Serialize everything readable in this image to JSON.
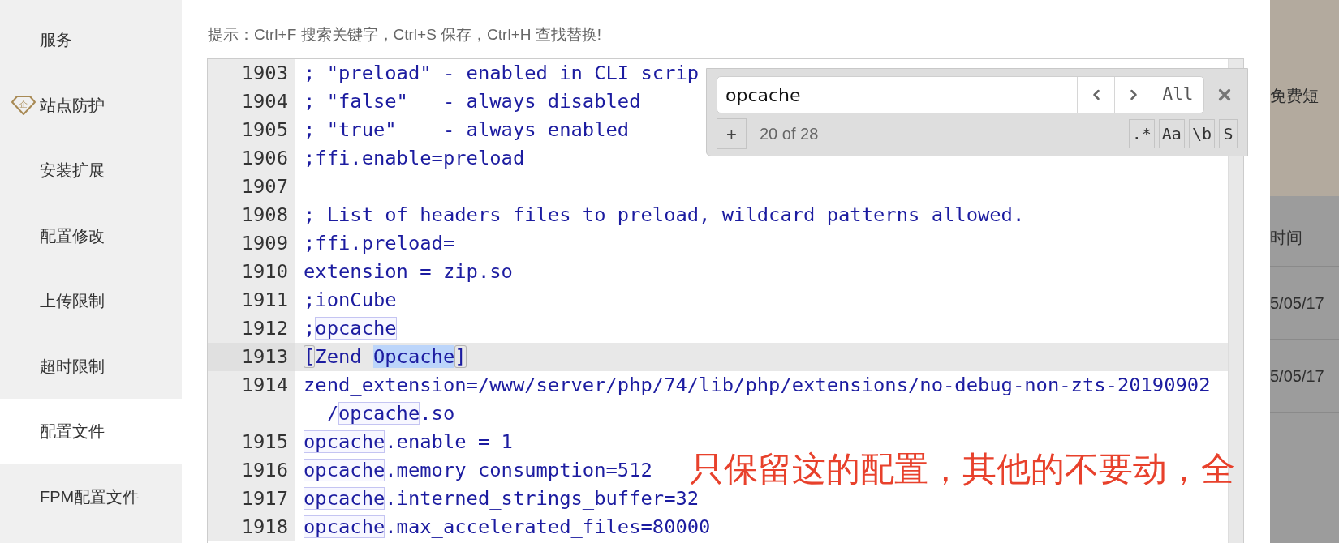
{
  "sidebar": {
    "items": [
      {
        "label": "服务",
        "selected": false
      },
      {
        "label": "站点防护",
        "selected": false,
        "badge": "企"
      },
      {
        "label": "安装扩展",
        "selected": false
      },
      {
        "label": "配置修改",
        "selected": false
      },
      {
        "label": "上传限制",
        "selected": false
      },
      {
        "label": "超时限制",
        "selected": false
      },
      {
        "label": "配置文件",
        "selected": true
      },
      {
        "label": "FPM配置文件",
        "selected": false
      }
    ]
  },
  "hint": "提示：Ctrl+F 搜索关键字，Ctrl+S 保存，Ctrl+H 查找替换!",
  "editor": {
    "lines": [
      {
        "number": "1903",
        "active": false,
        "rows": [
          [
            {
              "kind": "text",
              "text": "; \"preload\" - enabled in CLI scrip"
            }
          ]
        ]
      },
      {
        "number": "1904",
        "active": false,
        "rows": [
          [
            {
              "kind": "text",
              "text": "; \"false\"   - always disabled"
            }
          ]
        ]
      },
      {
        "number": "1905",
        "active": false,
        "rows": [
          [
            {
              "kind": "text",
              "text": "; \"true\"    - always enabled"
            }
          ]
        ]
      },
      {
        "number": "1906",
        "active": false,
        "rows": [
          [
            {
              "kind": "text",
              "text": ";ffi.enable=preload"
            }
          ]
        ]
      },
      {
        "number": "1907",
        "active": false,
        "rows": [
          []
        ]
      },
      {
        "number": "1908",
        "active": false,
        "rows": [
          [
            {
              "kind": "text",
              "text": "; List of headers files to preload, wildcard patterns allowed."
            }
          ]
        ]
      },
      {
        "number": "1909",
        "active": false,
        "rows": [
          [
            {
              "kind": "text",
              "text": ";ffi.preload="
            }
          ]
        ]
      },
      {
        "number": "1910",
        "active": false,
        "rows": [
          [
            {
              "kind": "text",
              "text": "extension = zip.so"
            }
          ]
        ]
      },
      {
        "number": "1911",
        "active": false,
        "rows": [
          [
            {
              "kind": "text",
              "text": ";ionCube"
            }
          ]
        ]
      },
      {
        "number": "1912",
        "active": false,
        "rows": [
          [
            {
              "kind": "text",
              "text": ";"
            },
            {
              "kind": "match",
              "text": "opcache"
            }
          ]
        ]
      },
      {
        "number": "1913",
        "active": true,
        "rows": [
          [
            {
              "kind": "bracket",
              "text": "["
            },
            {
              "kind": "text",
              "text": "Zend "
            },
            {
              "kind": "current",
              "text": "Opcache"
            },
            {
              "kind": "bracket",
              "text": "]"
            }
          ]
        ]
      },
      {
        "number": "1914",
        "active": false,
        "rows": [
          [
            {
              "kind": "text",
              "text": "zend_extension=/www/server/php/74/lib/php/extensions/no-debug-non-zts-20190902"
            }
          ],
          [
            {
              "kind": "text",
              "text": "  /"
            },
            {
              "kind": "match",
              "text": "opcache"
            },
            {
              "kind": "text",
              "text": ".so"
            }
          ]
        ]
      },
      {
        "number": "1915",
        "active": false,
        "rows": [
          [
            {
              "kind": "match",
              "text": "opcache"
            },
            {
              "kind": "text",
              "text": ".enable = 1"
            }
          ]
        ]
      },
      {
        "number": "1916",
        "active": false,
        "rows": [
          [
            {
              "kind": "match",
              "text": "opcache"
            },
            {
              "kind": "text",
              "text": ".memory_consumption=512"
            }
          ]
        ]
      },
      {
        "number": "1917",
        "active": false,
        "rows": [
          [
            {
              "kind": "match",
              "text": "opcache"
            },
            {
              "kind": "text",
              "text": ".interned_strings_buffer=32"
            }
          ]
        ]
      },
      {
        "number": "1918",
        "active": false,
        "rows": [
          [
            {
              "kind": "match",
              "text": "opcache"
            },
            {
              "kind": "text",
              "text": ".max_accelerated_files=80000"
            }
          ]
        ]
      }
    ]
  },
  "search": {
    "query": "opcache",
    "all": "All",
    "add": "+",
    "count": "20 of 28",
    "toggles": [
      ".*",
      "Aa",
      "\\b",
      "S"
    ]
  },
  "annotation": "只保留这的配置，其他的不要动，全",
  "background": {
    "banner": "免费短",
    "header": "时间",
    "rows": [
      "5/05/17",
      "5/05/17"
    ]
  }
}
